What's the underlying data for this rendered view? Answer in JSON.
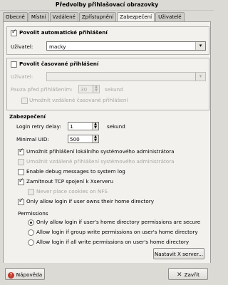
{
  "window": {
    "title": "Předvolby přihlašovací obrazovky"
  },
  "tabs": [
    {
      "label": "Obecné"
    },
    {
      "label": "Místní"
    },
    {
      "label": "Vzdálené"
    },
    {
      "label": "Zpřístupnění"
    },
    {
      "label": "Zabezpečení"
    },
    {
      "label": "Uživatelé"
    }
  ],
  "active_tab": "Zabezpečení",
  "auto_login": {
    "checkbox_label": "Povolit automatické přihlášení",
    "checked": true,
    "user_label": "Uživatel:",
    "user_value": "macky"
  },
  "timed_login": {
    "checkbox_label": "Povolit časované přihlášení",
    "checked": false,
    "user_label": "Uživatel:",
    "user_value": "",
    "pause_label": "Pauza před přihlášením:",
    "pause_value": "30",
    "pause_unit": "sekund",
    "remote_label": "Umožnit vzdálené časované přihlášení"
  },
  "security": {
    "heading": "Zabezpečení",
    "retry_label": "Login retry delay:",
    "retry_value": "1",
    "retry_unit": "sekund",
    "min_uid_label": "Minimal UID:",
    "min_uid_value": "500",
    "options": [
      {
        "label": "Umožnit přihlášení lokálního systémového administrátora",
        "checked": true,
        "disabled": false
      },
      {
        "label": "Umožnit vzdálené přihlášení systémového administrátora",
        "checked": false,
        "disabled": true
      },
      {
        "label": "Enable debug messages to system log",
        "checked": false,
        "disabled": false
      },
      {
        "label": "Zamítnout TCP spojení k Xserveru",
        "checked": true,
        "disabled": false
      },
      {
        "label": "Never place cookies on NFS",
        "checked": false,
        "disabled": true
      },
      {
        "label": "Only allow login if user owns their home directory",
        "checked": true,
        "disabled": false
      }
    ],
    "permissions_heading": "Permissions",
    "permissions": [
      {
        "label": "Only allow login if user's home directory permissions are secure",
        "selected": true
      },
      {
        "label": "Allow login if group write permissions on user's home directory",
        "selected": false
      },
      {
        "label": "Allow login if all write permissions on user's home directory",
        "selected": false
      }
    ],
    "xserver_button": "Nastavit X server..."
  },
  "footer": {
    "help_label": "Nápověda",
    "close_label": "Zavřít"
  }
}
